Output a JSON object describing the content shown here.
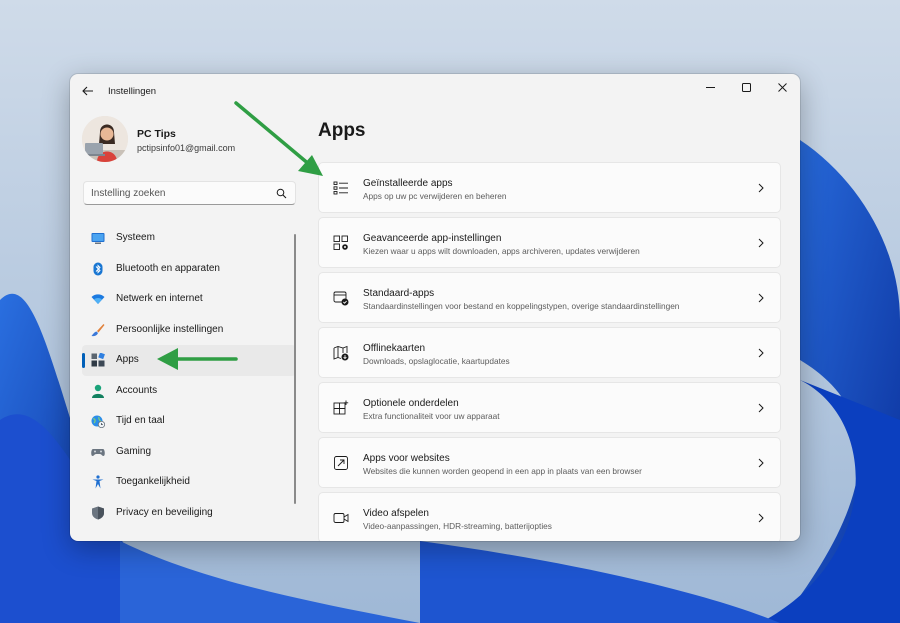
{
  "window": {
    "title": "Instellingen",
    "accent_color": "#005fb8"
  },
  "profile": {
    "name": "PC Tips",
    "email": "pctipsinfo01@gmail.com"
  },
  "search": {
    "placeholder": "Instelling zoeken",
    "icon": "search-icon"
  },
  "sidebar": {
    "items": [
      {
        "label": "Systeem",
        "icon": "monitor-icon",
        "selected": false
      },
      {
        "label": "Bluetooth en apparaten",
        "icon": "bluetooth-icon",
        "selected": false
      },
      {
        "label": "Netwerk en internet",
        "icon": "wifi-icon",
        "selected": false
      },
      {
        "label": "Persoonlijke instellingen",
        "icon": "brush-icon",
        "selected": false
      },
      {
        "label": "Apps",
        "icon": "apps-icon",
        "selected": true
      },
      {
        "label": "Accounts",
        "icon": "person-icon",
        "selected": false
      },
      {
        "label": "Tijd en taal",
        "icon": "globe-clock-icon",
        "selected": false
      },
      {
        "label": "Gaming",
        "icon": "gamepad-icon",
        "selected": false
      },
      {
        "label": "Toegankelijkheid",
        "icon": "accessibility-icon",
        "selected": false
      },
      {
        "label": "Privacy en beveiliging",
        "icon": "shield-icon",
        "selected": false
      }
    ]
  },
  "main": {
    "title": "Apps",
    "cards": [
      {
        "title": "Geïnstalleerde apps",
        "subtitle": "Apps op uw pc verwijderen en beheren",
        "icon": "list-icon"
      },
      {
        "title": "Geavanceerde app-instellingen",
        "subtitle": "Kiezen waar u apps wilt downloaden, apps archiveren, updates verwijderen",
        "icon": "apps-gear-icon"
      },
      {
        "title": "Standaard-apps",
        "subtitle": "Standaardinstellingen voor bestand en koppelingstypen, overige standaardinstellingen",
        "icon": "default-apps-icon"
      },
      {
        "title": "Offlinekaarten",
        "subtitle": "Downloads, opslaglocatie, kaartupdates",
        "icon": "map-download-icon"
      },
      {
        "title": "Optionele onderdelen",
        "subtitle": "Extra functionaliteit voor uw apparaat",
        "icon": "grid-add-icon"
      },
      {
        "title": "Apps voor websites",
        "subtitle": "Websites die kunnen worden geopend in een app in plaats van een browser",
        "icon": "open-in-app-icon"
      },
      {
        "title": "Video afspelen",
        "subtitle": "Video-aanpassingen, HDR-streaming, batterijopties",
        "icon": "video-icon"
      }
    ]
  },
  "annotations": {
    "arrow_color": "#2f9e44"
  }
}
